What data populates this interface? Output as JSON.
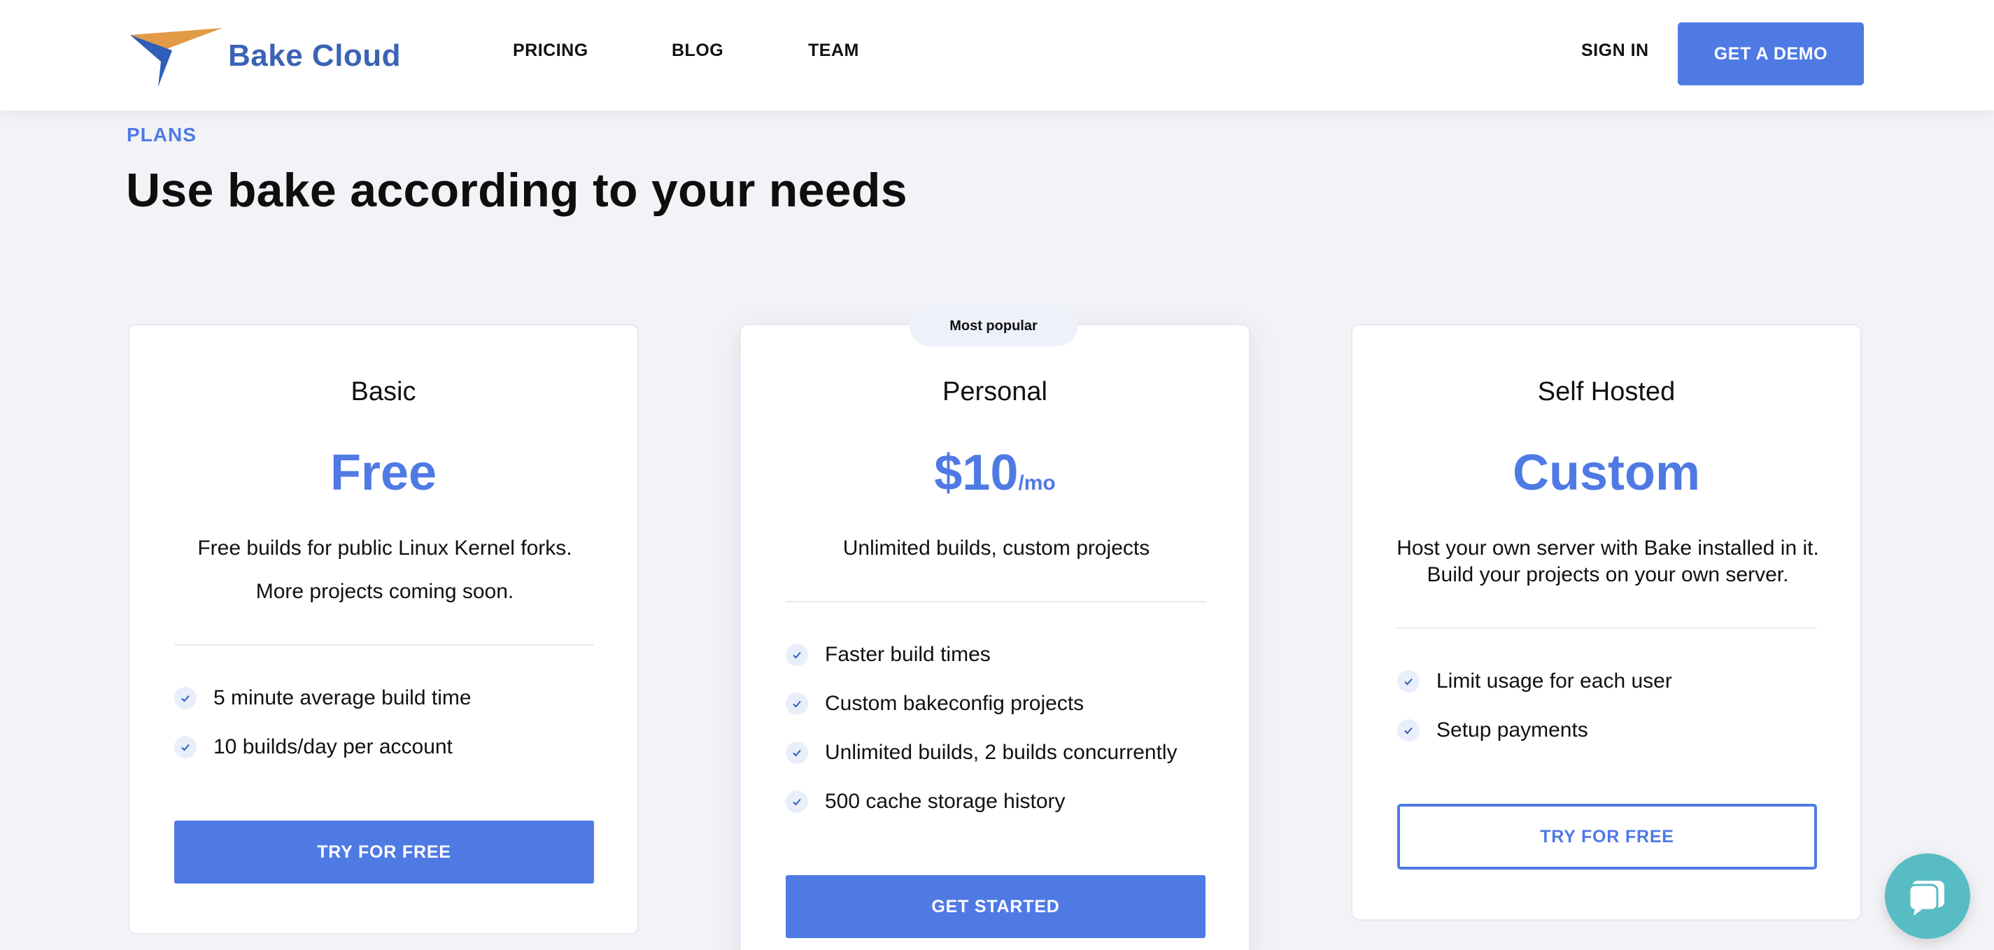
{
  "brand": {
    "name": "Bake Cloud"
  },
  "nav": [
    {
      "label": "PRICING"
    },
    {
      "label": "BLOG"
    },
    {
      "label": "TEAM"
    }
  ],
  "header": {
    "signin_label": "SIGN IN",
    "demo_label": "GET A DEMO"
  },
  "section": {
    "eyebrow": "PLANS",
    "headline": "Use bake according to your needs"
  },
  "plans": [
    {
      "name": "Basic",
      "price": "Free",
      "price_unit": "",
      "description": [
        "Free builds for public Linux Kernel forks.",
        "More projects coming soon."
      ],
      "features": [
        "5 minute average build time",
        "10 builds/day per account"
      ],
      "cta": "TRY FOR FREE"
    },
    {
      "name": "Personal",
      "badge": "Most popular",
      "price": "$10",
      "price_unit": "/mo",
      "description": [
        "Unlimited builds, custom projects"
      ],
      "features": [
        "Faster build times",
        "Custom bakeconfig projects",
        "Unlimited builds, 2 builds concurrently",
        "500 cache storage history"
      ],
      "cta": "GET STARTED"
    },
    {
      "name": "Self Hosted",
      "price": "Custom",
      "price_unit": "",
      "description": [
        "Host your own server with Bake installed in it. Build your projects on your own server."
      ],
      "features": [
        "Limit usage for each user",
        "Setup payments"
      ],
      "cta": "TRY FOR FREE"
    }
  ],
  "icons": {
    "check": "check-icon",
    "chat": "chat-icon",
    "logo": "bake-cloud-logo"
  },
  "colors": {
    "accent": "#4f7ae4",
    "brand_text": "#3b63b5",
    "chat": "#57bcc4",
    "background": "#f2f3f7"
  }
}
